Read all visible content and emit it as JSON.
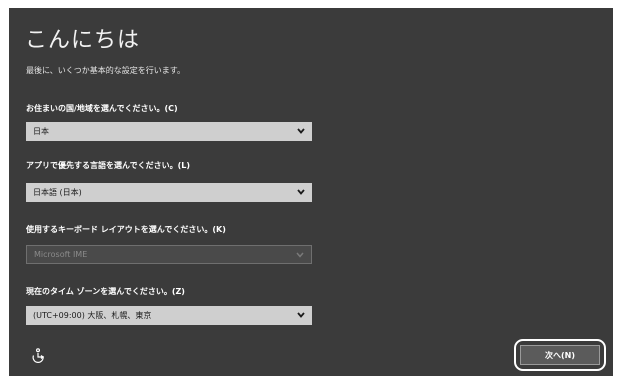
{
  "header": {
    "title": "こんにちは",
    "subtitle": "最後に、いくつか基本的な設定を行います。"
  },
  "fields": [
    {
      "label": "お住まいの国/地域を選んでください。(C)",
      "value": "日本",
      "enabled": true
    },
    {
      "label": "アプリで優先する言語を選んでください。(L)",
      "value": "日本語 (日本)",
      "enabled": true
    },
    {
      "label": "使用するキーボード レイアウトを選んでください。(K)",
      "value": "Microsoft IME",
      "enabled": false
    },
    {
      "label": "現在のタイム ゾーンを選んでください。(Z)",
      "value": "(UTC+09:00) 大阪、札幌、東京",
      "enabled": true
    }
  ],
  "footer": {
    "next_label": "次へ(N)",
    "accessibility_icon": "ease-of-access-icon"
  },
  "colors": {
    "background": "#3b3b3b",
    "select_enabled": "#cfcfcf",
    "select_disabled": "#4a4a4a",
    "button": "#5b5b5b"
  }
}
